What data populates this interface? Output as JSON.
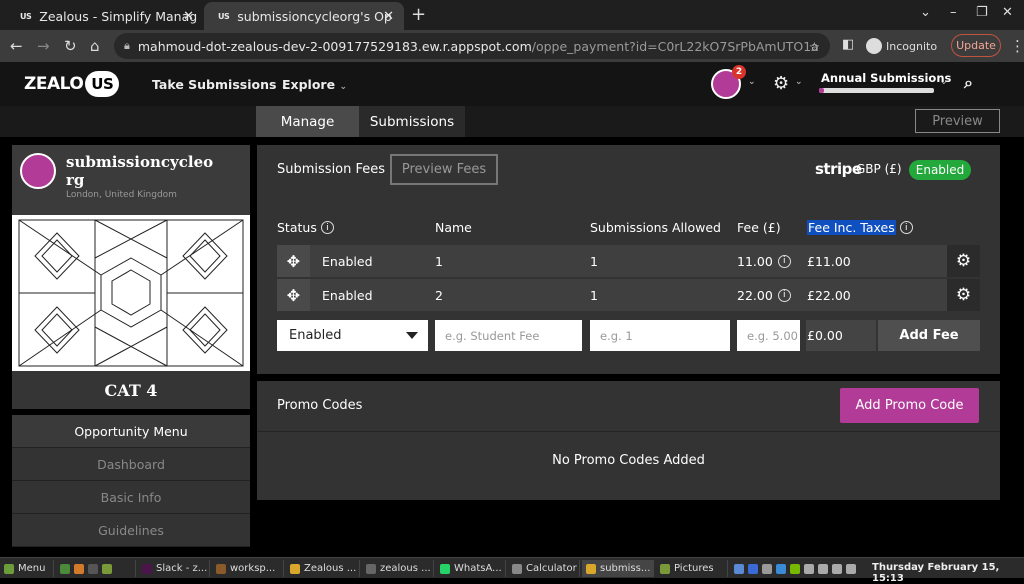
{
  "browser": {
    "tabs": [
      {
        "favicon": "US",
        "title": "Zealous - Simplify Manag"
      },
      {
        "favicon": "US",
        "title": "submissioncycleorg's Op"
      }
    ],
    "url_host": "mahmoud-dot-zealous-dev-2-009177529183.ew.r.appspot.com",
    "url_path": "/oppe_payment?id=C0rL22kO7SrPbAmUTO1a",
    "incognito_label": "Incognito",
    "update_label": "Update"
  },
  "app": {
    "logo_text": "ZEALO",
    "logo_badge": "US",
    "nav": [
      {
        "label": "Take Submissions"
      },
      {
        "label": "Explore"
      }
    ],
    "notification_count": "2",
    "annual_label": "Annual Submissions",
    "annual_progress": 0.04
  },
  "subnav": {
    "tabs": [
      {
        "label": "Manage"
      },
      {
        "label": "Submissions"
      }
    ],
    "preview_label": "Preview"
  },
  "sidebar": {
    "org_name_line1": "submissioncycleo",
    "org_name_line2": "rg",
    "location": "London, United Kingdom",
    "category": "CAT 4",
    "menu_title": "Opportunity Menu",
    "menu_items": [
      {
        "label": "Dashboard"
      },
      {
        "label": "Basic Info"
      },
      {
        "label": "Guidelines"
      }
    ]
  },
  "fees": {
    "title": "Submission Fees",
    "preview_label": "Preview Fees",
    "stripe_label": "stripe",
    "currency": "GBP (£)",
    "status": "Enabled",
    "columns": {
      "status": "Status",
      "name": "Name",
      "allowed": "Submissions Allowed",
      "fee": "Fee (£)",
      "fee_inc": "Fee Inc. Taxes"
    },
    "rows": [
      {
        "status": "Enabled",
        "name": "1",
        "allowed": "1",
        "fee": "11.00",
        "fee_inc": "£11.00"
      },
      {
        "status": "Enabled",
        "name": "2",
        "allowed": "1",
        "fee": "22.00",
        "fee_inc": "£22.00"
      }
    ],
    "new_row": {
      "status": "Enabled",
      "name_placeholder": "e.g. Student Fee",
      "allowed_placeholder": "e.g. 1",
      "fee_placeholder": "e.g. 5.00",
      "fee_inc": "£0.00",
      "add_label": "Add Fee"
    }
  },
  "promo": {
    "title": "Promo Codes",
    "add_label": "Add Promo Code",
    "empty": "No Promo Codes Added"
  },
  "taskbar": {
    "items": [
      {
        "label": "Menu"
      },
      {
        "label": "Slack - z..."
      },
      {
        "label": "worksp..."
      },
      {
        "label": "Zealous ..."
      },
      {
        "label": "zealous ..."
      },
      {
        "label": "WhatsA..."
      },
      {
        "label": "Calculator"
      },
      {
        "label": "submiss..."
      },
      {
        "label": "Pictures"
      }
    ],
    "clock": "Thursday February 15, 15:13"
  }
}
